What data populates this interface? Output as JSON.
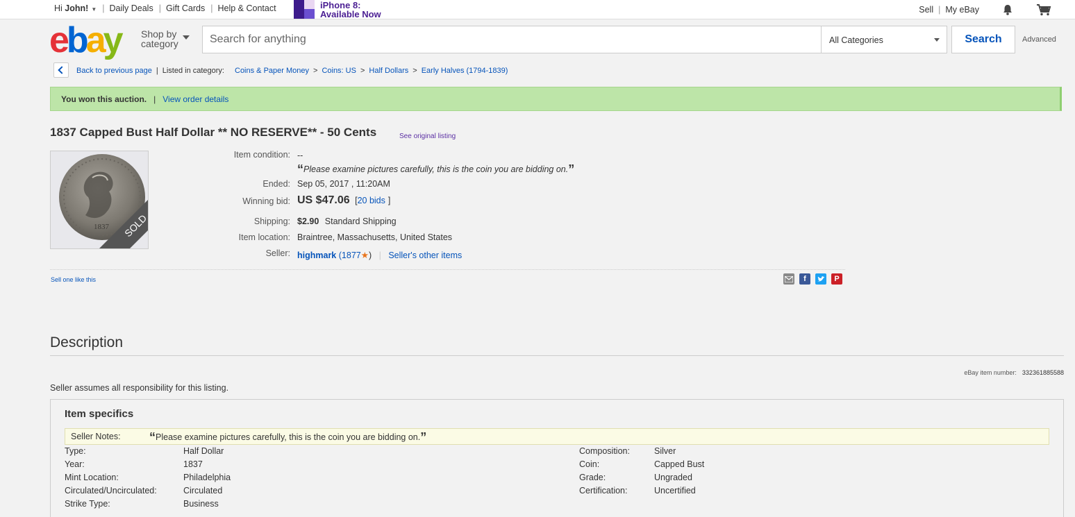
{
  "topbar": {
    "greeting_prefix": "Hi",
    "user_name": "John!",
    "daily_deals": "Daily Deals",
    "gift_cards": "Gift Cards",
    "help_contact": "Help & Contact",
    "promo_line1": "iPhone 8:",
    "promo_line2": "Available Now",
    "sell": "Sell",
    "my_ebay": "My eBay",
    "bell_icon": "bell-icon",
    "cart_icon": "cart-icon"
  },
  "header": {
    "logo": [
      "e",
      "b",
      "a",
      "y"
    ],
    "logo_colors": [
      "#e53238",
      "#0064d2",
      "#f5af02",
      "#86b817"
    ],
    "shop_by_line1": "Shop by",
    "shop_by_line2": "category",
    "search_placeholder": "Search for anything",
    "category_selected": "All Categories",
    "search_button": "Search",
    "advanced": "Advanced"
  },
  "breadcrumb": {
    "back": "Back to previous page",
    "listed_in": "Listed in category:",
    "items": [
      "Coins & Paper Money",
      "Coins: US",
      "Half Dollars",
      "Early Halves (1794-1839)"
    ]
  },
  "banner": {
    "won_text": "You won this auction.",
    "view_order": "View order details",
    "color": "#bde5a8"
  },
  "item": {
    "title": "1837 Capped Bust Half Dollar ** NO RESERVE** - 50 Cents",
    "see_original": "See original listing",
    "sold_badge": "SOLD",
    "coin_year_mark": "1837",
    "condition_label": "Item condition:",
    "condition_value": "--",
    "condition_note": "Please examine pictures carefully, this is the coin you are bidding on.",
    "ended_label": "Ended:",
    "ended_value": "Sep 05, 2017 , 11:20AM",
    "winning_bid_label": "Winning bid:",
    "winning_bid_value": "US $47.06",
    "bids_open": "[",
    "bids_link": "20 bids",
    "bids_close": "]",
    "shipping_label": "Shipping:",
    "shipping_price": "$2.90",
    "shipping_method": "Standard Shipping",
    "location_label": "Item location:",
    "location_value": "Braintree, Massachusetts, United States",
    "seller_label": "Seller:",
    "seller_name": "highmark",
    "seller_score_open": "(1877",
    "seller_score_close": ")",
    "seller_other": "Seller's other items",
    "sell_one": "Sell one like this",
    "share_icons": [
      "email-icon",
      "facebook-icon",
      "twitter-icon",
      "pinterest-icon"
    ]
  },
  "description": {
    "heading": "Description",
    "item_number_label": "eBay item number:",
    "item_number": "332361885588",
    "seller_assumes": "Seller assumes all responsibility for this listing.",
    "specifics_title": "Item specifics",
    "seller_notes_label": "Seller Notes:",
    "seller_notes_value": "Please examine pictures carefully, this is the coin you are bidding on.",
    "left_specs": [
      {
        "label": "Type:",
        "value": "Half Dollar"
      },
      {
        "label": "Year:",
        "value": "1837"
      },
      {
        "label": "Mint Location:",
        "value": "Philadelphia"
      },
      {
        "label": "Circulated/Uncirculated:",
        "value": "Circulated"
      },
      {
        "label": "Strike Type:",
        "value": "Business"
      }
    ],
    "right_specs": [
      {
        "label": "Composition:",
        "value": "Silver"
      },
      {
        "label": "Coin:",
        "value": "Capped Bust"
      },
      {
        "label": "Grade:",
        "value": "Ungraded"
      },
      {
        "label": "Certification:",
        "value": "Uncertified"
      }
    ]
  }
}
